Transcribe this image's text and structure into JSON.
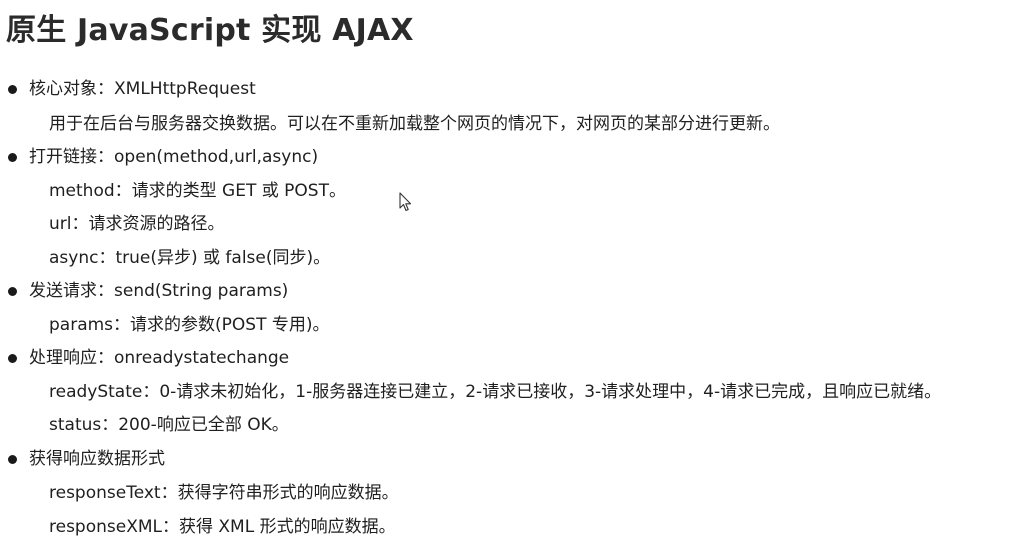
{
  "title": "原生 JavaScript 实现 AJAX",
  "sections": [
    {
      "heading": "核心对象：XMLHttpRequest",
      "lines": [
        "用于在后台与服务器交换数据。可以在不重新加载整个网页的情况下，对网页的某部分进行更新。"
      ]
    },
    {
      "heading": "打开链接：open(method,url,async)",
      "lines": [
        "method：请求的类型 GET 或 POST。",
        "url：请求资源的路径。",
        "async：true(异步) 或 false(同步)。"
      ]
    },
    {
      "heading": "发送请求：send(String params)",
      "lines": [
        "params：请求的参数(POST 专用)。"
      ]
    },
    {
      "heading": "处理响应：onreadystatechange",
      "lines": [
        "readyState：0-请求未初始化，1-服务器连接已建立，2-请求已接收，3-请求处理中，4-请求已完成，且响应已就绪。",
        "status：200-响应已全部 OK。"
      ]
    },
    {
      "heading": "获得响应数据形式",
      "lines": [
        "responseText：获得字符串形式的响应数据。",
        "responseXML：获得 XML 形式的响应数据。"
      ]
    }
  ],
  "icons": {
    "bullet": "bullet-dot-icon",
    "cursor": "mouse-pointer-icon"
  },
  "colors": {
    "text": "#1f1f1f",
    "title": "#2b2b2b",
    "background": "#ffffff"
  }
}
